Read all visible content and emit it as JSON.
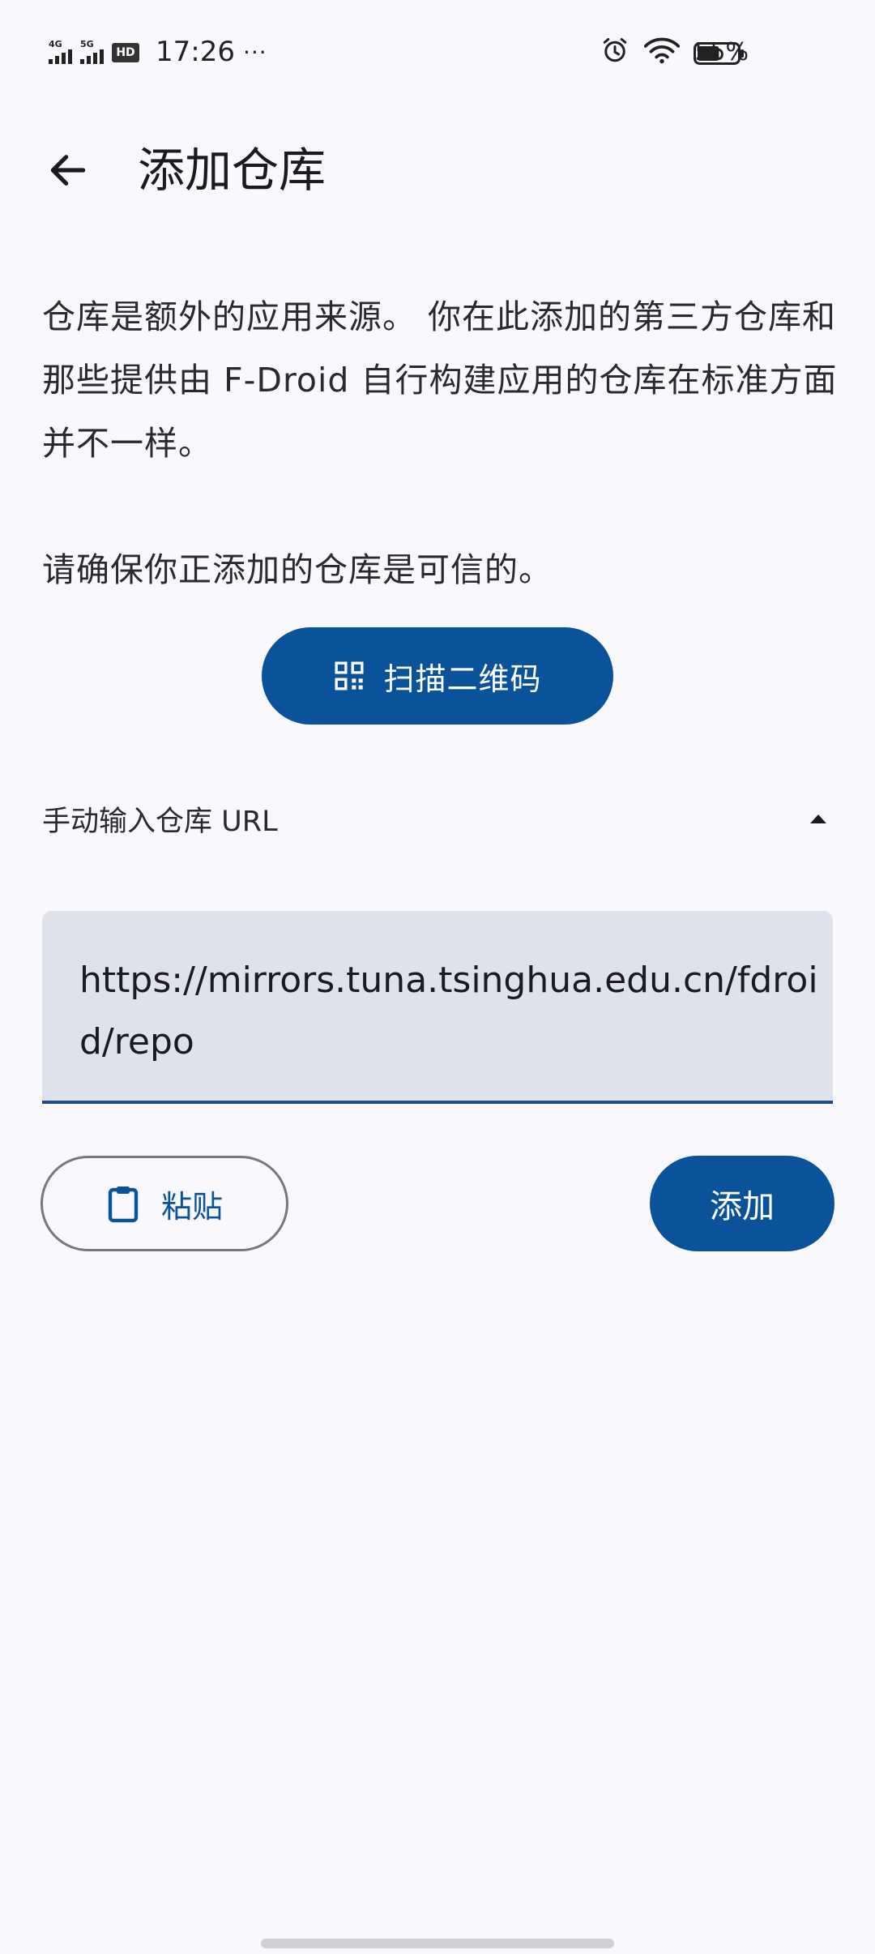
{
  "status_bar": {
    "signal1_label": "4G",
    "signal2_label": "5G",
    "hd_label": "HD",
    "time": "17:26",
    "more": "···",
    "battery_text": "55%",
    "battery_level": 0.55
  },
  "app_bar": {
    "title": "添加仓库"
  },
  "description": {
    "paragraph1": "仓库是额外的应用来源。 你在此添加的第三方仓库和那些提供由 F-Droid 自行构建应用的仓库在标准方面并不一样。",
    "paragraph2": "请确保你正添加的仓库是可信的。"
  },
  "scan_button": {
    "label": "扫描二维码"
  },
  "manual_section": {
    "label": "手动输入仓库 URL",
    "expanded": true
  },
  "url_input": {
    "value": "https://mirrors.tuna.tsinghua.edu.cn/fdroid/repo"
  },
  "actions": {
    "paste_label": "粘贴",
    "add_label": "添加"
  },
  "colors": {
    "primary": "#0a529a",
    "background": "#f8f8fd",
    "field_background": "#dfe2ea",
    "outline": "#76777f"
  }
}
